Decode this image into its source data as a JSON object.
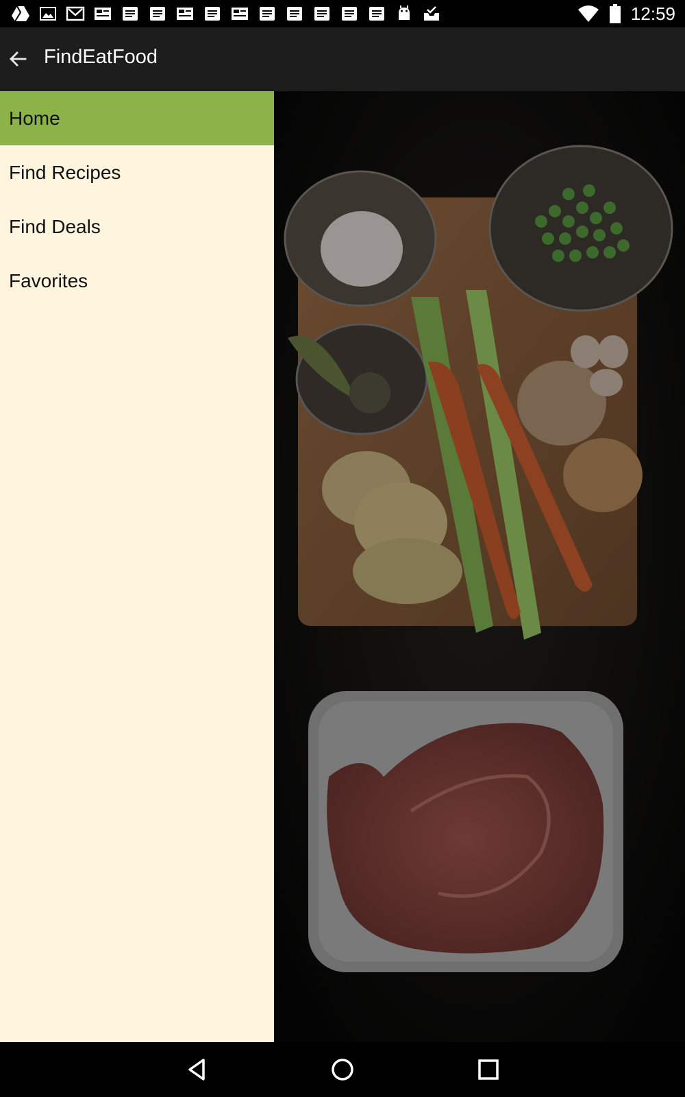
{
  "status_bar": {
    "time": "12:59",
    "notification_icons": [
      "drive-icon",
      "image-icon",
      "gmail-icon",
      "news-icon",
      "doc-icon",
      "doc-icon",
      "news-icon",
      "doc-icon",
      "news-icon",
      "doc-icon",
      "doc-icon",
      "doc-icon",
      "doc-icon",
      "doc-icon",
      "android-icon",
      "inbox-check-icon"
    ],
    "wifi_icon": "wifi-icon",
    "battery_icon": "battery-icon"
  },
  "app_bar": {
    "title": "FindEatFood",
    "back_icon": "back-arrow-icon"
  },
  "drawer": {
    "items": [
      {
        "label": "Home",
        "active": true
      },
      {
        "label": "Find Recipes",
        "active": false
      },
      {
        "label": "Find Deals",
        "active": false
      },
      {
        "label": "Favorites",
        "active": false
      }
    ],
    "active_color": "#8cb24a",
    "background_color": "#fff5df"
  },
  "content": {
    "image": "food-ingredients-image"
  },
  "nav_bar": {
    "back": "back-triangle-icon",
    "home": "home-circle-icon",
    "recents": "recents-square-icon"
  }
}
